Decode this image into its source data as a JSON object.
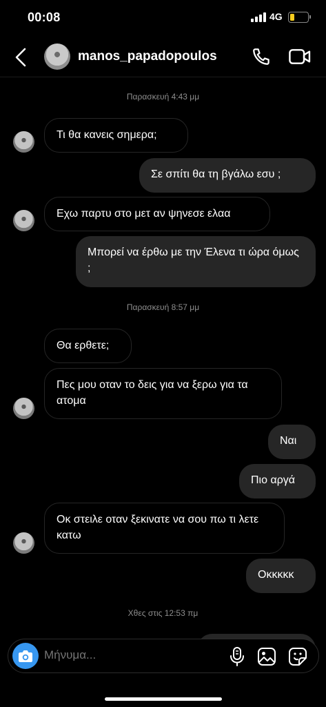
{
  "status_bar": {
    "time": "00:08",
    "network": "4G"
  },
  "header": {
    "username": "manos_papadopoulos"
  },
  "messages": [
    {
      "type": "timestamp",
      "text": "Παρασκευή 4:43 μμ"
    },
    {
      "type": "in",
      "text": "Τι θα κανεις σημερα;"
    },
    {
      "type": "out",
      "text": "Σε σπίτι θα τη βγάλω εσυ ;"
    },
    {
      "type": "in",
      "text": "Εχω παρτυ στο μετ αν ψηνεσε ελαα"
    },
    {
      "type": "out",
      "text": "Μπορεί να έρθω με την Έλενα τι ώρα όμως ;"
    },
    {
      "type": "timestamp",
      "text": "Παρασκευή 8:57 μμ"
    },
    {
      "type": "in",
      "text": "Θα ερθετε;"
    },
    {
      "type": "in",
      "text": "Πες μου οταν το δεις για να ξερω για τα ατομα"
    },
    {
      "type": "out",
      "text": "Ναι"
    },
    {
      "type": "out",
      "text": "Πιο αργά"
    },
    {
      "type": "in",
      "text": "Οκ στειλε οταν ξεκινατε να σου πω τι λετε κατω"
    },
    {
      "type": "out",
      "text": "Οκκκκκ"
    },
    {
      "type": "timestamp",
      "text": "Χθες στις 12:53 πμ"
    }
  ],
  "composer": {
    "placeholder": "Μήνυμα..."
  },
  "icons": {
    "back": "chevron-left-icon",
    "call": "phone-icon",
    "video": "video-camera-icon",
    "camera": "camera-icon",
    "mic": "microphone-icon",
    "gallery": "image-icon",
    "sticker": "sticker-icon"
  },
  "colors": {
    "background": "#000000",
    "bubble_out": "#262626",
    "camera_button": "#3797f0",
    "battery": "#f5cc1e"
  }
}
